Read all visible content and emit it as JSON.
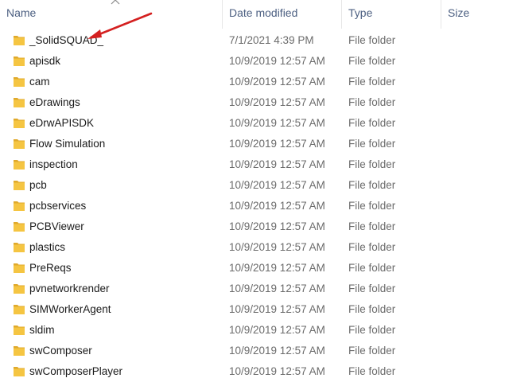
{
  "columns": {
    "name": "Name",
    "date_modified": "Date modified",
    "type": "Type",
    "size": "Size"
  },
  "sort": {
    "column": "name",
    "direction": "ascending"
  },
  "colors": {
    "folder": "#f5c542",
    "folder_tab": "#e0a92b",
    "annotation_arrow": "#d42020",
    "header_text": "#4d6082"
  },
  "files": [
    {
      "name": "_SolidSQUAD_",
      "date": "7/1/2021 4:39 PM",
      "type": "File folder",
      "size": ""
    },
    {
      "name": "apisdk",
      "date": "10/9/2019 12:57 AM",
      "type": "File folder",
      "size": ""
    },
    {
      "name": "cam",
      "date": "10/9/2019 12:57 AM",
      "type": "File folder",
      "size": ""
    },
    {
      "name": "eDrawings",
      "date": "10/9/2019 12:57 AM",
      "type": "File folder",
      "size": ""
    },
    {
      "name": "eDrwAPISDK",
      "date": "10/9/2019 12:57 AM",
      "type": "File folder",
      "size": ""
    },
    {
      "name": "Flow Simulation",
      "date": "10/9/2019 12:57 AM",
      "type": "File folder",
      "size": ""
    },
    {
      "name": "inspection",
      "date": "10/9/2019 12:57 AM",
      "type": "File folder",
      "size": ""
    },
    {
      "name": "pcb",
      "date": "10/9/2019 12:57 AM",
      "type": "File folder",
      "size": ""
    },
    {
      "name": "pcbservices",
      "date": "10/9/2019 12:57 AM",
      "type": "File folder",
      "size": ""
    },
    {
      "name": "PCBViewer",
      "date": "10/9/2019 12:57 AM",
      "type": "File folder",
      "size": ""
    },
    {
      "name": "plastics",
      "date": "10/9/2019 12:57 AM",
      "type": "File folder",
      "size": ""
    },
    {
      "name": "PreReqs",
      "date": "10/9/2019 12:57 AM",
      "type": "File folder",
      "size": ""
    },
    {
      "name": "pvnetworkrender",
      "date": "10/9/2019 12:57 AM",
      "type": "File folder",
      "size": ""
    },
    {
      "name": "SIMWorkerAgent",
      "date": "10/9/2019 12:57 AM",
      "type": "File folder",
      "size": ""
    },
    {
      "name": "sldim",
      "date": "10/9/2019 12:57 AM",
      "type": "File folder",
      "size": ""
    },
    {
      "name": "swComposer",
      "date": "10/9/2019 12:57 AM",
      "type": "File folder",
      "size": ""
    },
    {
      "name": "swComposerPlayer",
      "date": "10/9/2019 12:57 AM",
      "type": "File folder",
      "size": ""
    }
  ]
}
